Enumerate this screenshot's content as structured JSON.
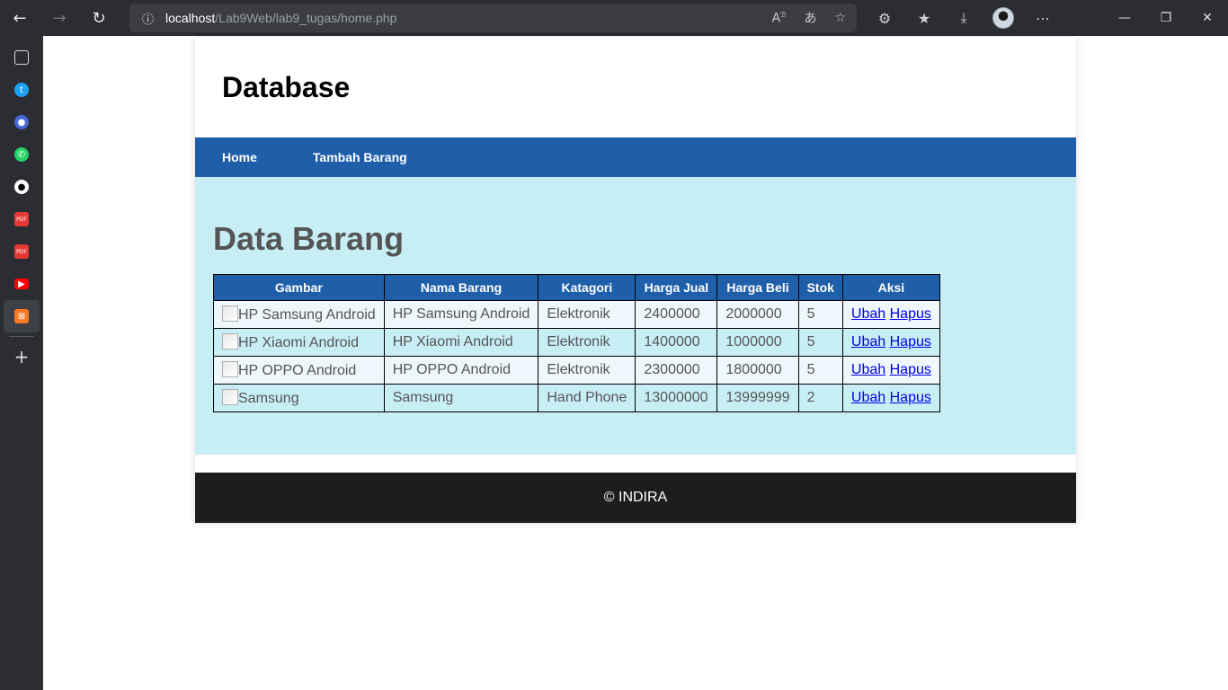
{
  "browser": {
    "url_host": "localhost",
    "url_path": "/Lab9Web/lab9_tugas/home.php"
  },
  "page": {
    "header_title": "Database",
    "nav": [
      {
        "label": "Home"
      },
      {
        "label": "Tambah Barang"
      }
    ],
    "section_title": "Data Barang",
    "table": {
      "columns": [
        "Gambar",
        "Nama Barang",
        "Katagori",
        "Harga Jual",
        "Harga Beli",
        "Stok",
        "Aksi"
      ],
      "rows": [
        {
          "gambar_alt": "HP Samsung Android",
          "nama": "HP Samsung Android",
          "kategori": "Elektronik",
          "harga_jual": "2400000",
          "harga_beli": "2000000",
          "stok": "5",
          "ubah": "Ubah",
          "hapus": "Hapus"
        },
        {
          "gambar_alt": "HP Xiaomi Android",
          "nama": "HP Xiaomi Android",
          "kategori": "Elektronik",
          "harga_jual": "1400000",
          "harga_beli": "1000000",
          "stok": "5",
          "ubah": "Ubah",
          "hapus": "Hapus"
        },
        {
          "gambar_alt": "HP OPPO Android",
          "nama": "HP OPPO Android",
          "kategori": "Elektronik",
          "harga_jual": "2300000",
          "harga_beli": "1800000",
          "stok": "5",
          "ubah": "Ubah",
          "hapus": "Hapus"
        },
        {
          "gambar_alt": "Samsung",
          "nama": "Samsung",
          "kategori": "Hand Phone",
          "harga_jual": "13000000",
          "harga_beli": "13999999",
          "stok": "2",
          "ubah": "Ubah",
          "hapus": "Hapus"
        }
      ]
    },
    "footer": "© INDIRA"
  },
  "colors": {
    "nav_blue": "#1f5faa",
    "content_bg": "#c8eef5",
    "footer_bg": "#1d1d1d"
  }
}
